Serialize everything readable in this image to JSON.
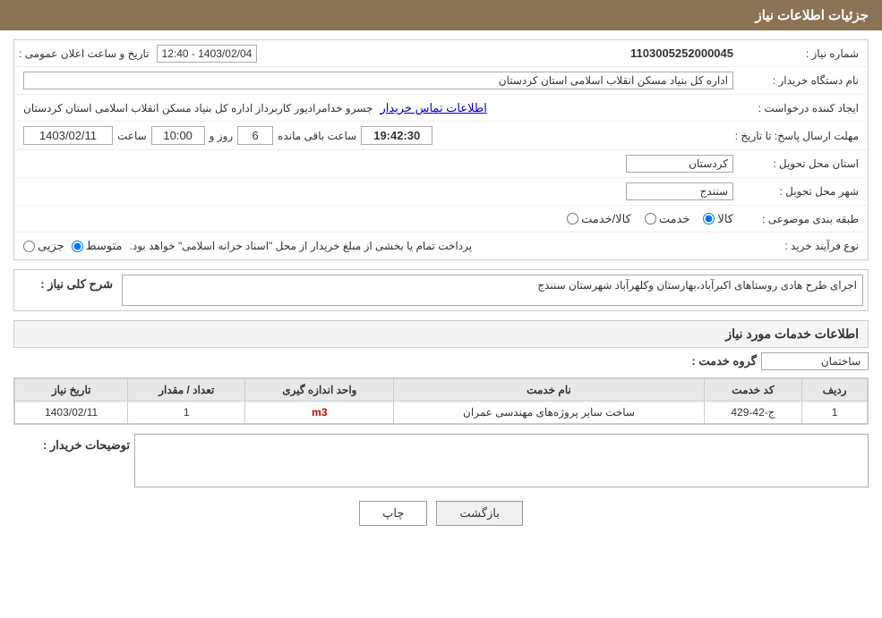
{
  "header": {
    "title": "جزئیات اطلاعات نیاز"
  },
  "labels": {
    "request_number": "شماره نیاز :",
    "buyer_org": "نام دستگاه خریدار :",
    "requester": "ایجاد کننده درخواست :",
    "response_deadline": "مهلت ارسال پاسخ: تا تاریخ :",
    "delivery_province": "استان محل تحویل :",
    "delivery_city": "شهر محل تحویل :",
    "category": "طبقه بندی موضوعی :",
    "process_type": "نوع فرآیند خرید :",
    "general_description": "شرح کلی نیاز :",
    "services_info": "اطلاعات خدمات مورد نیاز",
    "service_group": "گروه خدمت :",
    "buyer_notes": "توضیحات خریدار :"
  },
  "values": {
    "request_number": "1103005252000045",
    "announce_time_label": "تاریخ و ساعت اعلان عمومی :",
    "announce_time_value": "1403/02/04 - 12:40",
    "buyer_org": "اداره کل بنیاد مسکن انقلاب اسلامی استان کردستان",
    "requester_name": "جسرو خدامرادیور کاربرداز اداره کل بنیاد مسکن انقلاب اسلامی استان کردستان",
    "requester_link": "اطلاعات تماس خریدار",
    "deadline_date": "1403/02/11",
    "deadline_time_label": "ساعت",
    "deadline_time": "10:00",
    "deadline_days_label": "روز و",
    "deadline_days": "6",
    "deadline_remaining_label": "ساعت باقی مانده",
    "deadline_remaining": "19:42:30",
    "delivery_province": "کردستان",
    "delivery_city": "سنندج",
    "category_options": [
      "کالا",
      "خدمت",
      "کالا/خدمت"
    ],
    "category_selected": "کالا",
    "process_options": [
      "جزیی",
      "متوسط"
    ],
    "process_selected": "متوسط",
    "payment_note": "پرداخت تمام یا بخشی از مبلغ خریدار از محل \"اسناد خزانه اسلامی\" خواهد بود.",
    "general_description_text": "اجرای طرح هادی روستاهای اکبرآباد،بهارستان وکلهرآباد شهرستان سنندج",
    "service_group_value": "ساختمان",
    "table_headers": [
      "ردیف",
      "کد خدمت",
      "نام خدمت",
      "واحد اندازه گیری",
      "تعداد / مقدار",
      "تاریخ نیاز"
    ],
    "table_rows": [
      {
        "row": "1",
        "code": "ج-42-429",
        "name": "ساخت سایر پروژه‌های مهندسی عمران",
        "unit": "m3",
        "quantity": "1",
        "date": "1403/02/11"
      }
    ],
    "btn_print": "چاپ",
    "btn_back": "بازگشت"
  }
}
